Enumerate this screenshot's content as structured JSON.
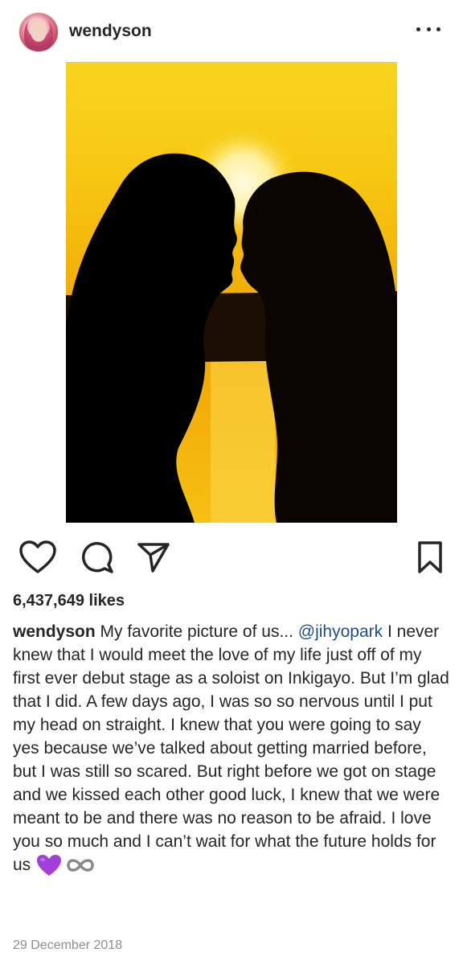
{
  "post": {
    "username": "wendyson",
    "likes": "6,437,649 likes",
    "caption": {
      "username": "wendyson",
      "text_before": " My favorite picture of us... ",
      "mention": "@jihyopark",
      "text_after": " I never knew that I would meet the love of my life just off of my first ever debut stage as a soloist on Inkigayo. But I’m glad that I did. A few days ago, I was so so nervous until I put my head on straight. I knew that you were going to say yes because we’ve talked about getting married before, but I was still so scared. But right before we got on stage and we kissed each other good luck, I knew that we were meant to be and there was no reason to be afraid. I love you so much and I can’t wait for what the future holds for us",
      "emojis": [
        "purple-heart",
        "infinity"
      ]
    },
    "date": "29 December 2018"
  },
  "icons": {
    "like": "heart-icon",
    "comment": "comment-icon",
    "share": "paper-plane-icon",
    "save": "bookmark-icon",
    "more": "more-options-icon"
  },
  "colors": {
    "text": "#262626",
    "mention": "#1c4f8c",
    "date": "#8e8e8e",
    "heart_emoji": "#a23fd8",
    "sunset": "#f7c410"
  }
}
